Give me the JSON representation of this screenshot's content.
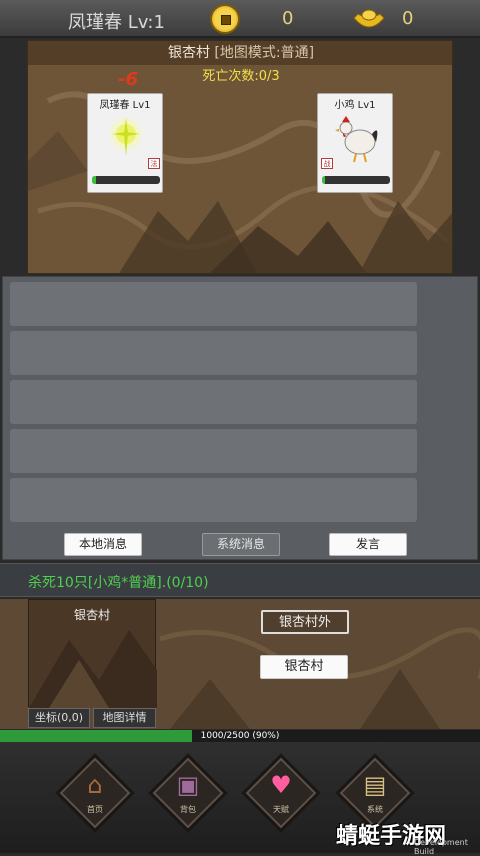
{
  "header": {
    "player": "凤瑾春 Lv:1",
    "coins": "0",
    "ingots": "0"
  },
  "battle": {
    "title": "银杏村",
    "mode": "[地图模式:普通]",
    "deaths": "死亡次数:0/3",
    "damage": "-6",
    "player": {
      "name": "凤瑾春 Lv1",
      "tag": "法",
      "hp": 0.06
    },
    "enemy": {
      "name": "小鸡 Lv1",
      "tag": "战",
      "hp": 0.05
    }
  },
  "chat": {
    "buttons": {
      "local": "本地消息",
      "system": "系统消息",
      "speak": "发言"
    }
  },
  "quest": {
    "text": "杀死10只[小鸡*普通].(0/10)"
  },
  "location": {
    "mini_title": "银杏村",
    "coord": "坐标(0,0)",
    "detail": "地图详情",
    "outer": "银杏村外",
    "current": "银杏村"
  },
  "exp": {
    "text": "1000/2500 (90%)",
    "fraction": 0.4
  },
  "nav": [
    "首页",
    "背包",
    "天赋",
    "系统"
  ],
  "watermark": {
    "main": "蜻蜓手游网",
    "sub": "Development Build"
  },
  "colors": {
    "quest_green": "#4fd04f",
    "hp_green": "#3fbf3f",
    "damage_red": "#e03a1e"
  }
}
